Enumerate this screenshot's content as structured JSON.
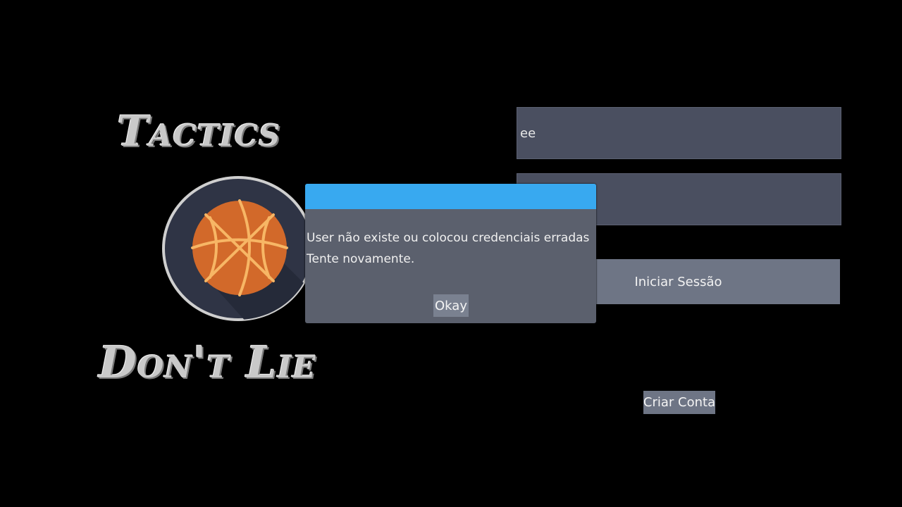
{
  "logo": {
    "line1": "Tactics",
    "line2": "Don't Lie"
  },
  "login": {
    "username_value": "ee",
    "password_value": "",
    "submit_label": "Iniciar Sessão",
    "create_account_label": "Criar Conta"
  },
  "dialog": {
    "title": "",
    "message_line1": "User não existe ou colocou credenciais erradas",
    "message_line2": "Tente novamente.",
    "ok_label": "Okay"
  },
  "colors": {
    "background": "#000000",
    "field": "#4a4f60",
    "button": "#6e7585",
    "dialog_body": "#5b606d",
    "dialog_titlebar": "#38a9f0",
    "ball": "#d2692a"
  },
  "icons": {
    "logo_ball": "basketball-icon"
  }
}
